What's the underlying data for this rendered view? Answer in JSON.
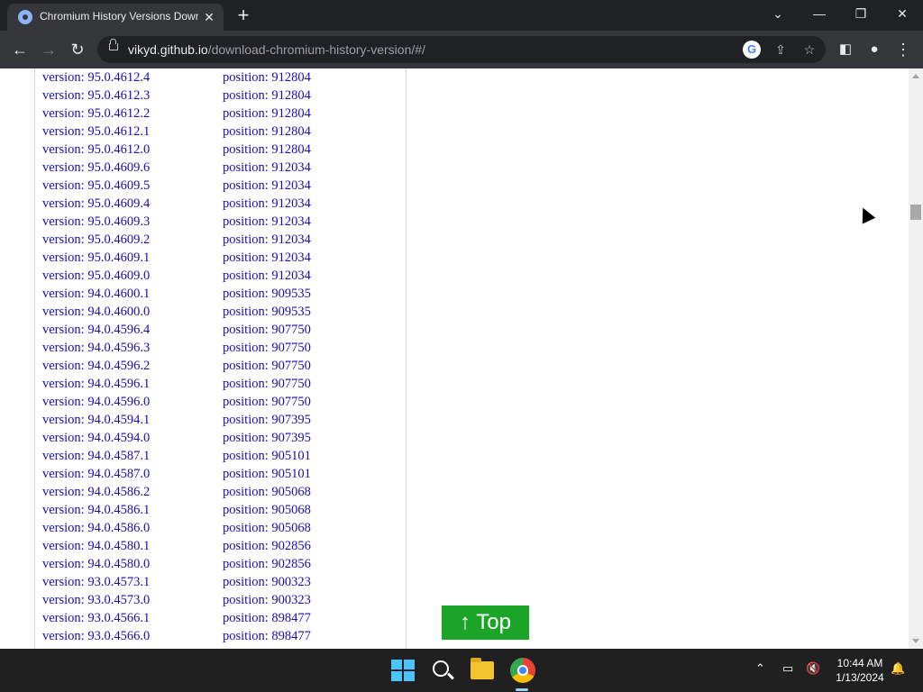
{
  "browser": {
    "tab_title": "Chromium History Versions Down",
    "url_host": "vikyd.github.io",
    "url_path": "/download-chromium-history-version/#/"
  },
  "rows": [
    {
      "version": "version: 95.0.4612.4",
      "position": "position: 912804"
    },
    {
      "version": "version: 95.0.4612.3",
      "position": "position: 912804"
    },
    {
      "version": "version: 95.0.4612.2",
      "position": "position: 912804"
    },
    {
      "version": "version: 95.0.4612.1",
      "position": "position: 912804"
    },
    {
      "version": "version: 95.0.4612.0",
      "position": "position: 912804"
    },
    {
      "version": "version: 95.0.4609.6",
      "position": "position: 912034"
    },
    {
      "version": "version: 95.0.4609.5",
      "position": "position: 912034"
    },
    {
      "version": "version: 95.0.4609.4",
      "position": "position: 912034"
    },
    {
      "version": "version: 95.0.4609.3",
      "position": "position: 912034"
    },
    {
      "version": "version: 95.0.4609.2",
      "position": "position: 912034"
    },
    {
      "version": "version: 95.0.4609.1",
      "position": "position: 912034"
    },
    {
      "version": "version: 95.0.4609.0",
      "position": "position: 912034"
    },
    {
      "version": "version: 94.0.4600.1",
      "position": "position: 909535"
    },
    {
      "version": "version: 94.0.4600.0",
      "position": "position: 909535"
    },
    {
      "version": "version: 94.0.4596.4",
      "position": "position: 907750"
    },
    {
      "version": "version: 94.0.4596.3",
      "position": "position: 907750"
    },
    {
      "version": "version: 94.0.4596.2",
      "position": "position: 907750"
    },
    {
      "version": "version: 94.0.4596.1",
      "position": "position: 907750"
    },
    {
      "version": "version: 94.0.4596.0",
      "position": "position: 907750"
    },
    {
      "version": "version: 94.0.4594.1",
      "position": "position: 907395"
    },
    {
      "version": "version: 94.0.4594.0",
      "position": "position: 907395"
    },
    {
      "version": "version: 94.0.4587.1",
      "position": "position: 905101"
    },
    {
      "version": "version: 94.0.4587.0",
      "position": "position: 905101"
    },
    {
      "version": "version: 94.0.4586.2",
      "position": "position: 905068"
    },
    {
      "version": "version: 94.0.4586.1",
      "position": "position: 905068"
    },
    {
      "version": "version: 94.0.4586.0",
      "position": "position: 905068"
    },
    {
      "version": "version: 94.0.4580.1",
      "position": "position: 902856"
    },
    {
      "version": "version: 94.0.4580.0",
      "position": "position: 902856"
    },
    {
      "version": "version: 93.0.4573.1",
      "position": "position: 900323"
    },
    {
      "version": "version: 93.0.4573.0",
      "position": "position: 900323"
    },
    {
      "version": "version: 93.0.4566.1",
      "position": "position: 898477"
    },
    {
      "version": "version: 93.0.4566.0",
      "position": "position: 898477"
    }
  ],
  "top_button": "↑ Top",
  "taskbar": {
    "time": "10:44 AM",
    "date": "1/13/2024"
  },
  "colors": {
    "link": "#1a0dab",
    "top_button_bg": "#1aa529"
  }
}
